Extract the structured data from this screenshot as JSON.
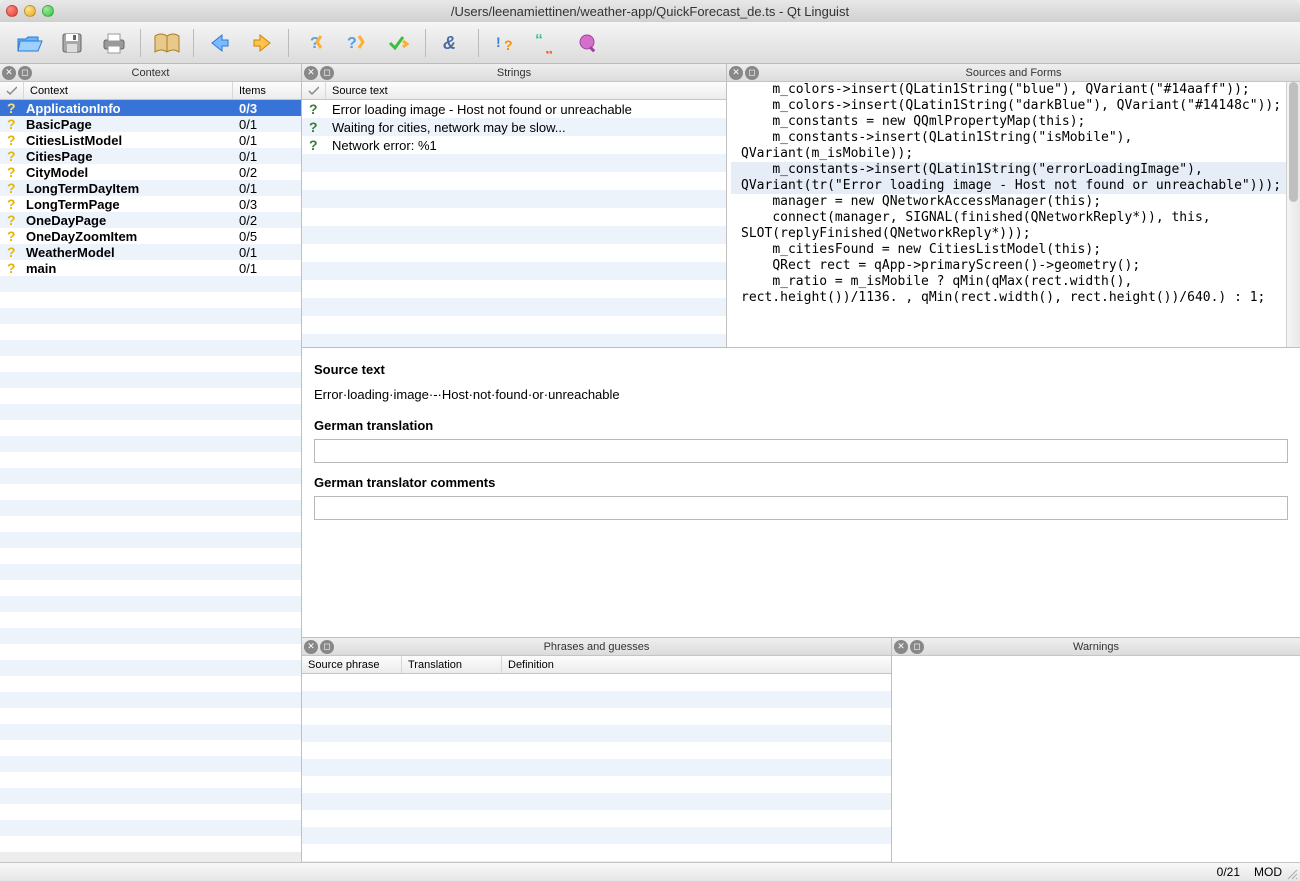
{
  "window": {
    "title": "/Users/leenamiettinen/weather-app/QuickForecast_de.ts - Qt Linguist"
  },
  "toolbar": {
    "icons": [
      "open",
      "save",
      "print",
      "phrasebook",
      "back",
      "forward",
      "prev-unfinished",
      "next-unfinished",
      "done-next",
      "search",
      "validation",
      "punctuation",
      "whats-this"
    ]
  },
  "panels": {
    "context": {
      "title": "Context",
      "col_context": "Context",
      "col_items": "Items"
    },
    "strings": {
      "title": "Strings",
      "col_source": "Source text"
    },
    "sources": {
      "title": "Sources and Forms"
    },
    "phrases": {
      "title": "Phrases and guesses",
      "col_source": "Source phrase",
      "col_translation": "Translation",
      "col_definition": "Definition"
    },
    "warnings": {
      "title": "Warnings"
    }
  },
  "contexts": [
    {
      "name": "ApplicationInfo",
      "count": "0/3",
      "selected": true
    },
    {
      "name": "BasicPage",
      "count": "0/1"
    },
    {
      "name": "CitiesListModel",
      "count": "0/1"
    },
    {
      "name": "CitiesPage",
      "count": "0/1"
    },
    {
      "name": "CityModel",
      "count": "0/2"
    },
    {
      "name": "LongTermDayItem",
      "count": "0/1"
    },
    {
      "name": "LongTermPage",
      "count": "0/3"
    },
    {
      "name": "OneDayPage",
      "count": "0/2"
    },
    {
      "name": "OneDayZoomItem",
      "count": "0/5"
    },
    {
      "name": "WeatherModel",
      "count": "0/1"
    },
    {
      "name": "main",
      "count": "0/1"
    }
  ],
  "strings": [
    {
      "text": "Error loading image - Host not found or unreachable",
      "selected": true
    },
    {
      "text": "Waiting for cities, network may be slow..."
    },
    {
      "text": "Network error: %1"
    }
  ],
  "source_code": [
    {
      "t": "    m_colors->insert(QLatin1String(\"blue\"), QVariant(\"#14aaff\"));"
    },
    {
      "t": "    m_colors->insert(QLatin1String(\"darkBlue\"), QVariant(\"#14148c\"));"
    },
    {
      "t": ""
    },
    {
      "t": "    m_constants = new QQmlPropertyMap(this);"
    },
    {
      "t": "    m_constants->insert(QLatin1String(\"isMobile\"), QVariant(m_isMobile));"
    },
    {
      "t": "    m_constants->insert(QLatin1String(\"errorLoadingImage\"), QVariant(tr(\"Error loading image - Host not found or unreachable\")));",
      "hl": true
    },
    {
      "t": ""
    },
    {
      "t": "    manager = new QNetworkAccessManager(this);"
    },
    {
      "t": "    connect(manager, SIGNAL(finished(QNetworkReply*)), this, SLOT(replyFinished(QNetworkReply*)));"
    },
    {
      "t": "    m_citiesFound = new CitiesListModel(this);"
    },
    {
      "t": ""
    },
    {
      "t": "    QRect rect = qApp->primaryScreen()->geometry();"
    },
    {
      "t": "    m_ratio = m_isMobile ? qMin(qMax(rect.width(), rect.height())/1136. , qMin(rect.width(), rect.height())/640.) : 1;"
    }
  ],
  "form": {
    "source_label": "Source text",
    "source_text": "Error·loading·image·-·Host·not·found·or·unreachable",
    "translation_label": "German translation",
    "translation_value": "",
    "comments_label": "German translator comments",
    "comments_value": ""
  },
  "status": {
    "progress": "0/21",
    "mod": "MOD"
  }
}
